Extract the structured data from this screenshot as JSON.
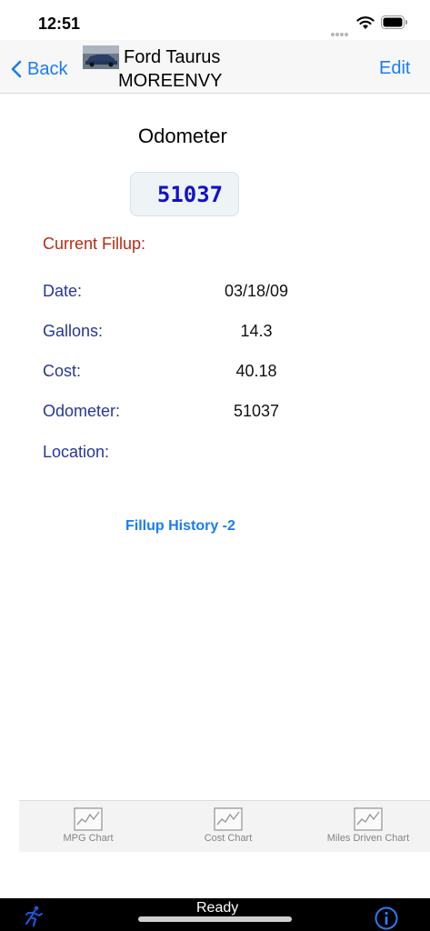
{
  "status_bar": {
    "time": "12:51"
  },
  "nav": {
    "back_label": "Back",
    "title_line1": "Ford Taurus",
    "title_line2": "MOREENVY",
    "edit_label": "Edit"
  },
  "odometer": {
    "title": "Odometer",
    "value": "51037"
  },
  "current_fillup": {
    "heading": "Current Fillup:",
    "date_label": "Date:",
    "date_value": "03/18/09",
    "gallons_label": "Gallons:",
    "gallons_value": "14.3",
    "cost_label": "Cost:",
    "cost_value": "40.18",
    "odometer_label": "Odometer:",
    "odometer_value": "51037",
    "location_label": "Location:",
    "location_value": ""
  },
  "history_link": "Fillup History -2",
  "tabs": [
    {
      "label": "MPG Chart",
      "icon": "chart-icon"
    },
    {
      "label": "Cost Chart",
      "icon": "chart-icon"
    },
    {
      "label": "Miles Driven Chart",
      "icon": "chart-icon"
    }
  ],
  "toolbar": {
    "status": "Ready"
  },
  "colors": {
    "accent": "#1a7cf0",
    "label_blue": "#27369a",
    "heading_red": "#b42d14",
    "odometer_digits": "#1111cc"
  }
}
